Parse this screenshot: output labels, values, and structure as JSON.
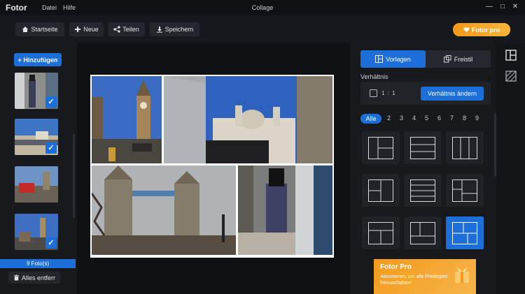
{
  "app": {
    "name": "Fotor",
    "window_title": "Collage"
  },
  "menu": [
    {
      "label": "Datei"
    },
    {
      "label": "Hilfe"
    }
  ],
  "window_controls": {
    "minimize": "—",
    "maximize": "□",
    "close": "✕"
  },
  "toolbar": {
    "home_label": "Startseite",
    "new_label": "Neue",
    "share_label": "Teilen",
    "save_label": "Speichern",
    "pro_label": "Fotor pro"
  },
  "left_panel": {
    "add_label": "+ Hinzufügen",
    "photos": [
      {
        "name": "guard-photo",
        "checked": true
      },
      {
        "name": "street-photo",
        "checked": true
      },
      {
        "name": "bus-photo",
        "checked": true
      },
      {
        "name": "bigben-photo",
        "checked": true
      }
    ],
    "count_label": "9 Foto(s)",
    "remove_label": "Alles entferr"
  },
  "right_panel": {
    "tab_templates": "Vorlagen",
    "tab_freestyle": "Freistil",
    "ratio_title": "Verhältnis",
    "ratio_value": "1 : 1",
    "ratio_button": "Verhältnis ändern",
    "counts": [
      "Alle",
      "2",
      "3",
      "4",
      "5",
      "6",
      "7",
      "8",
      "9"
    ],
    "active_count": "Alle",
    "selected_template": 8,
    "banner": {
      "title": "Fotor Pro",
      "text": "Abonnieren, um alle Privilegien freizuschalten!"
    }
  },
  "colors": {
    "accent": "#1c6fd8",
    "pro": "#f39a1b",
    "background": "#121417"
  }
}
